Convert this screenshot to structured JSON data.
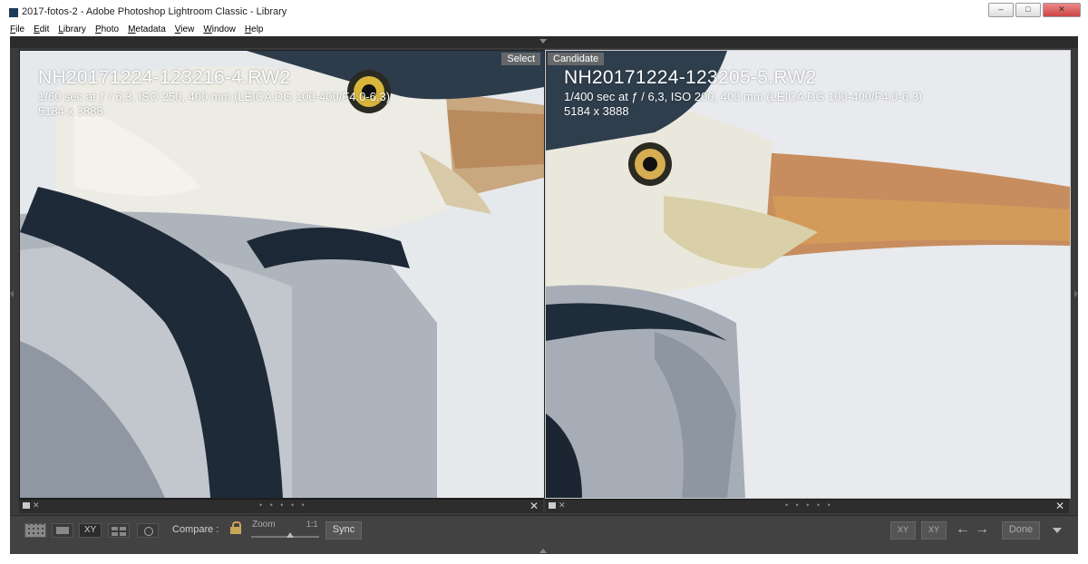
{
  "window": {
    "title": "2017-fotos-2 - Adobe Photoshop Lightroom Classic - Library",
    "controls": [
      "–",
      "□",
      "✕"
    ]
  },
  "menu": [
    "File",
    "Edit",
    "Library",
    "Photo",
    "Metadata",
    "View",
    "Window",
    "Help"
  ],
  "select_panel": {
    "badge": "Select",
    "filename": "NH20171224-123216-4.RW2",
    "exposure": "1/60 sec at ƒ / 6,3, ISO 250, 400 mm (LEICA DG 100-400/F4.0-6.3)",
    "dimensions": "5184 x 3888"
  },
  "candidate_panel": {
    "badge": "Candidate",
    "filename": "NH20171224-123205-5.RW2",
    "exposure": "1/400 sec at ƒ / 6,3, ISO 200, 400 mm (LEICA DG 100-400/F4.0-6.3)",
    "dimensions": "5184 x 3888"
  },
  "subbar": {
    "dots": "• • • • •",
    "close": "✕",
    "reject": "✕"
  },
  "toolbar": {
    "compare_view_label": "XY",
    "compare_label": "Compare :",
    "zoom_label": "Zoom",
    "zoom_ratio": "1:1",
    "sync_label": "Sync",
    "swap_a": "XY",
    "swap_b": "XY",
    "prev": "←",
    "next": "→",
    "done_label": "Done"
  },
  "colors": {
    "accent_lock": "#c9a55a",
    "panel_bg": "#3a3a3a",
    "toolbar_bg": "#424242"
  },
  "icons": [
    "grid-icon",
    "loupe-icon",
    "compare-icon",
    "survey-icon",
    "people-icon",
    "lock-icon",
    "swap-icon",
    "arrow-left-icon",
    "arrow-right-icon",
    "flag-icon"
  ]
}
